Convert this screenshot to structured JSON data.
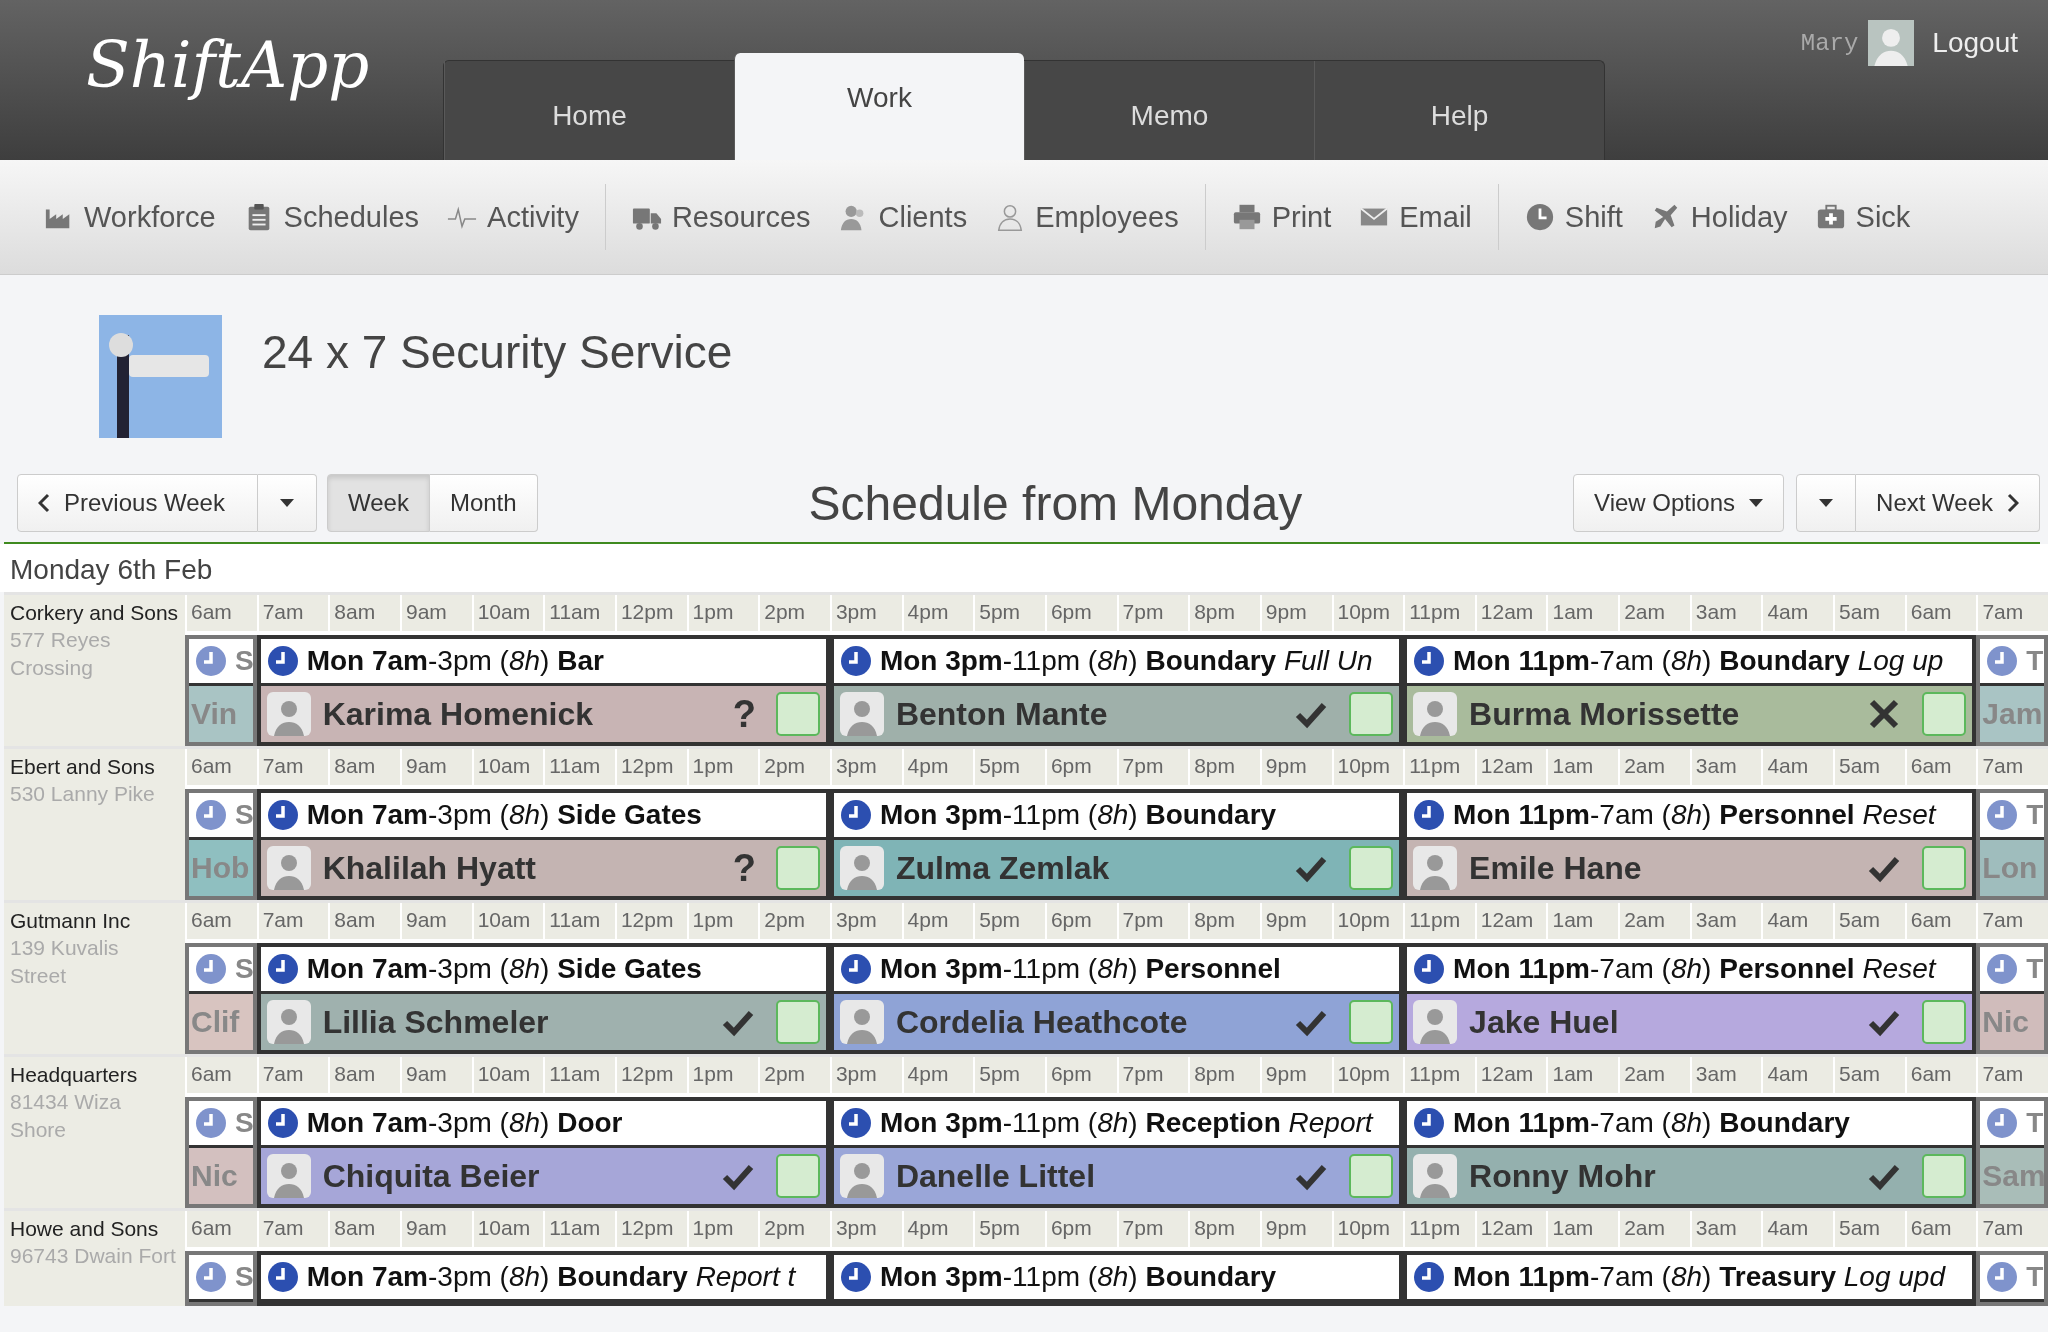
{
  "app": {
    "logo": "ShiftApp",
    "user": "Mary",
    "logout": "Logout"
  },
  "tabs": [
    {
      "label": "Home",
      "selected": false
    },
    {
      "label": "Work",
      "selected": true
    },
    {
      "label": "Memo",
      "selected": false
    },
    {
      "label": "Help",
      "selected": false
    }
  ],
  "toolbar": [
    [
      {
        "label": "Workforce"
      },
      {
        "label": "Schedules"
      },
      {
        "label": "Activity"
      }
    ],
    [
      {
        "label": "Resources"
      },
      {
        "label": "Clients"
      },
      {
        "label": "Employees"
      }
    ],
    [
      {
        "label": "Print"
      },
      {
        "label": "Email"
      }
    ],
    [
      {
        "label": "Shift"
      },
      {
        "label": "Holiday"
      },
      {
        "label": "Sick"
      }
    ]
  ],
  "site": {
    "title": "24 x 7 Security Service"
  },
  "controls": {
    "previous": "Previous Week",
    "views": [
      {
        "label": "Week",
        "selected": true
      },
      {
        "label": "Month",
        "selected": false
      }
    ],
    "heading": "Schedule from Monday",
    "view_options": "View Options",
    "next": "Next Week"
  },
  "day": "Monday 6th Feb",
  "clients": [
    {
      "name": "Corkery and Sons",
      "address": "577 Reyes Crossing",
      "hours": [
        "6am",
        "7am",
        "8am",
        "9am",
        "10am",
        "11am",
        "12pm",
        "1pm",
        "2pm",
        "3pm",
        "4pm",
        "5pm",
        "6pm",
        "7pm",
        "8pm",
        "9pm",
        "10pm",
        "11pm",
        "12am",
        "1am",
        "2am",
        "3am",
        "4am",
        "5am",
        "6am",
        "7am"
      ],
      "shifts": [
        {
          "kind": "edge",
          "line": "S",
          "person": "Vin",
          "color": "#a9c4c4"
        },
        {
          "kind": "full",
          "line": "**Mon 7am**-3pm (*8h*) **Bar**",
          "person": "Karima Homenick",
          "color": "#c8b4b4",
          "status": {
            "kind": "query",
            "text": "?"
          },
          "checked": false
        },
        {
          "kind": "full",
          "line": "**Mon 3pm**-11pm (*8h*) **Boundary** *Full Un*",
          "person": "Benton Mante",
          "color": "#9fb0aa",
          "status": {
            "kind": "confirmed"
          },
          "checked": false
        },
        {
          "kind": "full",
          "line": "**Mon 11pm**-7am (*8h*) **Boundary** *Log up*",
          "person": "Burma Morissette",
          "color": "#a9bb9c",
          "status": {
            "kind": "declined"
          },
          "checked": false
        },
        {
          "kind": "edge",
          "line": "T",
          "person": "Jam",
          "color": "#a9c4c4"
        }
      ]
    },
    {
      "name": "Ebert and Sons",
      "address": "530 Lanny Pike",
      "hours": [
        "6am",
        "7am",
        "8am",
        "9am",
        "10am",
        "11am",
        "12pm",
        "1pm",
        "2pm",
        "3pm",
        "4pm",
        "5pm",
        "6pm",
        "7pm",
        "8pm",
        "9pm",
        "10pm",
        "11pm",
        "12am",
        "1am",
        "2am",
        "3am",
        "4am",
        "5am",
        "6am",
        "7am"
      ],
      "shifts": [
        {
          "kind": "edge",
          "line": "S",
          "person": "Hob",
          "color": "#8fbfc0"
        },
        {
          "kind": "full",
          "line": "**Mon 7am**-3pm (*8h*) **Side Gates**",
          "person": "Khalilah Hyatt",
          "color": "#c4b4b2",
          "status": {
            "kind": "query",
            "text": "?"
          },
          "checked": false
        },
        {
          "kind": "full",
          "line": "**Mon 3pm**-11pm (*8h*) **Boundary**",
          "person": "Zulma Zemlak",
          "color": "#7fb4b6",
          "status": {
            "kind": "confirmed"
          },
          "checked": false
        },
        {
          "kind": "full",
          "line": "**Mon 11pm**-7am (*8h*) **Personnel** *Reset*",
          "person": "Emile Hane",
          "color": "#c4b4b2",
          "status": {
            "kind": "confirmed"
          },
          "checked": false
        },
        {
          "kind": "edge",
          "line": "T",
          "person": "Lon",
          "color": "#9fbdbd"
        }
      ]
    },
    {
      "name": "Gutmann Inc",
      "address": "139 Kuvalis Street",
      "hours": [
        "6am",
        "7am",
        "8am",
        "9am",
        "10am",
        "11am",
        "12pm",
        "1pm",
        "2pm",
        "3pm",
        "4pm",
        "5pm",
        "6pm",
        "7pm",
        "8pm",
        "9pm",
        "10pm",
        "11pm",
        "12am",
        "1am",
        "2am",
        "3am",
        "4am",
        "5am",
        "6am",
        "7am"
      ],
      "shifts": [
        {
          "kind": "edge",
          "line": "S",
          "person": "Clif",
          "color": "#d8c4c0"
        },
        {
          "kind": "full",
          "line": "**Mon 7am**-3pm (*8h*) **Side Gates**",
          "person": "Lillia Schmeler",
          "color": "#9fb1ae",
          "status": {
            "kind": "confirmed"
          },
          "checked": false
        },
        {
          "kind": "full",
          "line": "**Mon 3pm**-11pm (*8h*) **Personnel**",
          "person": "Cordelia Heathcote",
          "color": "#8fa3d6",
          "status": {
            "kind": "confirmed"
          },
          "checked": false
        },
        {
          "kind": "full",
          "line": "**Mon 11pm**-7am (*8h*) **Personnel** *Reset*",
          "person": "Jake Huel",
          "color": "#b6a9de",
          "status": {
            "kind": "confirmed"
          },
          "checked": false
        },
        {
          "kind": "edge",
          "line": "T",
          "person": "Nic",
          "color": "#d0bcbb"
        }
      ]
    },
    {
      "name": "Headquarters",
      "address": "81434 Wiza Shore",
      "hours": [
        "6am",
        "7am",
        "8am",
        "9am",
        "10am",
        "11am",
        "12pm",
        "1pm",
        "2pm",
        "3pm",
        "4pm",
        "5pm",
        "6pm",
        "7pm",
        "8pm",
        "9pm",
        "10pm",
        "11pm",
        "12am",
        "1am",
        "2am",
        "3am",
        "4am",
        "5am",
        "6am",
        "7am"
      ],
      "shifts": [
        {
          "kind": "edge",
          "line": "S",
          "person": "Nic",
          "color": "#d3c0bf"
        },
        {
          "kind": "full",
          "line": "**Mon 7am**-3pm (*8h*) **Door**",
          "person": "Chiquita Beier",
          "color": "#a6a6d8",
          "status": {
            "kind": "confirmed"
          },
          "checked": false
        },
        {
          "kind": "full",
          "line": "**Mon 3pm**-11pm (*8h*) **Reception** *Report*",
          "person": "Danelle Littel",
          "color": "#9aa6d8",
          "status": {
            "kind": "confirmed"
          },
          "checked": false
        },
        {
          "kind": "full",
          "line": "**Mon 11pm**-7am (*8h*) **Boundary**",
          "person": "Ronny Mohr",
          "color": "#94b0ae",
          "status": {
            "kind": "confirmed"
          },
          "checked": false
        },
        {
          "kind": "edge",
          "line": "T",
          "person": "Sam",
          "color": "#a9bdb8"
        }
      ]
    },
    {
      "name": "Howe and Sons",
      "address": "96743 Dwain Fort",
      "hours": [
        "6am",
        "7am",
        "8am",
        "9am",
        "10am",
        "11am",
        "12pm",
        "1pm",
        "2pm",
        "3pm",
        "4pm",
        "5pm",
        "6pm",
        "7pm",
        "8pm",
        "9pm",
        "10pm",
        "11pm",
        "12am",
        "1am",
        "2am",
        "3am",
        "4am",
        "5am",
        "6am",
        "7am"
      ],
      "shifts": [
        {
          "kind": "edge",
          "line": "S"
        },
        {
          "kind": "full",
          "line": "**Mon 7am**-3pm (*8h*) **Boundary** *Report t*"
        },
        {
          "kind": "full",
          "line": "**Mon 3pm**-11pm (*8h*) **Boundary**"
        },
        {
          "kind": "full",
          "line": "**Mon 11pm**-7am (*8h*) **Treasury** *Log upd*"
        },
        {
          "kind": "edge",
          "line": "T"
        }
      ]
    }
  ]
}
